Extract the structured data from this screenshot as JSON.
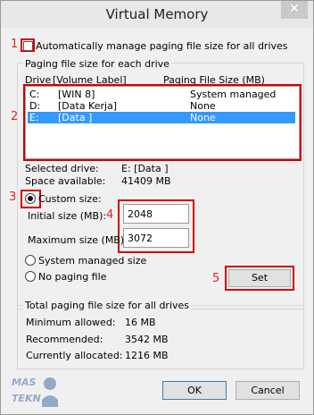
{
  "window": {
    "title": "Virtual Memory",
    "close_glyph": "✕"
  },
  "annotations": [
    "1",
    "2",
    "3",
    "4",
    "5"
  ],
  "auto_manage": {
    "label": "Automatically manage paging file size for all drives",
    "checked": false
  },
  "paging_group": {
    "title": "Paging file size for each drive",
    "col_drive": "Drive",
    "col_volume": "[Volume Label]",
    "col_size": "Paging File Size (MB)",
    "drives": [
      {
        "drive": "C:",
        "label": "[WIN 8]",
        "size": "System managed",
        "selected": false
      },
      {
        "drive": "D:",
        "label": "[Data Kerja]",
        "size": "None",
        "selected": false
      },
      {
        "drive": "E:",
        "label": "[Data ]",
        "size": "None",
        "selected": true
      }
    ]
  },
  "selected_drive": {
    "label": "Selected drive:",
    "value": "E:  [Data ]"
  },
  "space_available": {
    "label": "Space available:",
    "value": "41409 MB"
  },
  "custom_size": {
    "label": "Custom size:",
    "selected": true
  },
  "initial_size": {
    "label": "Initial size (MB):",
    "value": "2048"
  },
  "maximum_size": {
    "label": "Maximum size (MB):",
    "value": "3072"
  },
  "system_managed": {
    "label": "System managed size"
  },
  "no_paging": {
    "label": "No paging file"
  },
  "set_button": "Set",
  "totals": {
    "title": "Total paging file size for all drives",
    "min_label": "Minimum allowed:",
    "min_value": "16 MB",
    "rec_label": "Recommended:",
    "rec_value": "3542 MB",
    "cur_label": "Currently allocated:",
    "cur_value": "1216 MB"
  },
  "ok_button": "OK",
  "cancel_button": "Cancel",
  "watermark": "MAS TEKNO",
  "colors": {
    "annotation": "#d40000",
    "selection": "#3399ff"
  }
}
